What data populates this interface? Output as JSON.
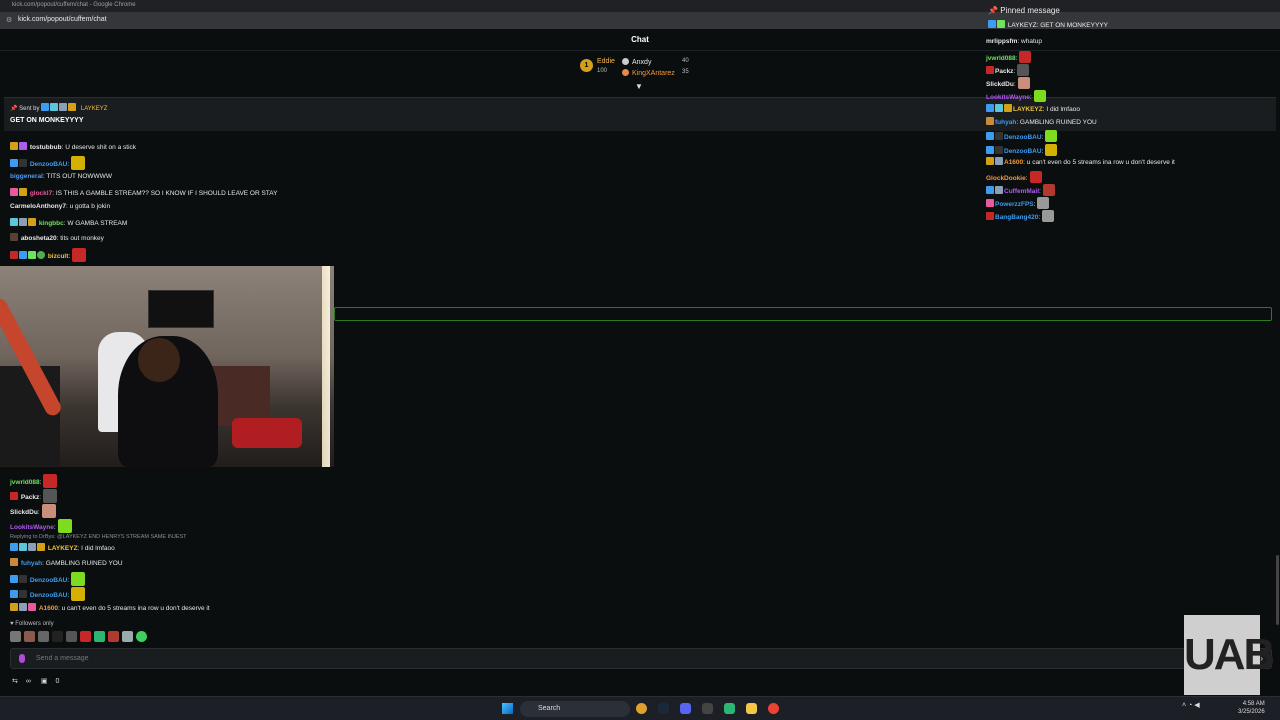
{
  "browser": {
    "window_title": "kick.com/popout/cuffem/chat - Google Chrome",
    "url": "kick.com/popout/cuffem/chat"
  },
  "chat": {
    "title": "Chat",
    "leaderboard": {
      "top": {
        "rank": "1",
        "name": "Eddie",
        "count": "100"
      },
      "rows": [
        {
          "name": "Anxdy",
          "count": "40",
          "color": "#e8e8e8"
        },
        {
          "name": "KingXAntarez",
          "count": "35",
          "color": "#f39a3a"
        }
      ]
    },
    "pinned": {
      "sent_by_label": "Sent by",
      "sender": "LAYKEYZ",
      "message": "GET ON MONKEYYYY"
    },
    "messages_top": [
      {
        "user": "tostubbub",
        "color": "#e8e8e8",
        "text": ": U deserve shit on a stick"
      },
      {
        "user": "DenzooBAU",
        "color": "#3d9cf0",
        "text": ":"
      },
      {
        "user": "biggeneral",
        "color": "#4f9cf4",
        "text": ": TITS OUT NOWWWW"
      },
      {
        "user": "glockl7",
        "color": "#e85a9b",
        "text": ": IS THIS A GAMBLE STREAM?? SO I KNOW IF I SHOULD LEAVE OR STAY"
      },
      {
        "user": "CarmeloAnthony7",
        "color": "#e8e8e8",
        "text": ": u gotta b jokin"
      },
      {
        "user": "kingbbc",
        "color": "#6fe35a",
        "text": ": W GAMBA STREAM"
      },
      {
        "user": "abosheta20",
        "color": "#e8e8e8",
        "text": ": tits out monkey"
      },
      {
        "user": "bizcult",
        "color": "#f0c23b",
        "text": ":"
      }
    ],
    "messages_bottom": [
      {
        "user": "jvwrld088",
        "color": "#6fe35a",
        "text": ":"
      },
      {
        "user": "Packz",
        "color": "#e8e8e8",
        "text": ":"
      },
      {
        "user": "SlickdDu",
        "color": "#e8e8e8",
        "text": ":"
      },
      {
        "user": "LookitsWayne",
        "color": "#b05bf0",
        "text": ":"
      },
      {
        "user": "LAYKEYZ",
        "color": "#f0c23b",
        "text": ": I did lmfaoo"
      },
      {
        "user": "fuhyah",
        "color": "#3d9cf0",
        "text": ": GAMBLING RUINED YOU"
      },
      {
        "user": "DenzooBAU",
        "color": "#3d9cf0",
        "text": ":"
      },
      {
        "user": "DenzooBAU",
        "color": "#3d9cf0",
        "text": ":"
      },
      {
        "user": "A1600",
        "color": "#f39a3a",
        "text": ": u can't even do 5 streams ina row u don't deserve it"
      }
    ],
    "reply_note": "Replying to DrBys: @LAYKEYZ END HENRYS STREAM SAME INJEST",
    "followers_only": "Followers only",
    "input_placeholder": "Send a message",
    "bottom_stats": {
      "a": "∞",
      "b": "0"
    }
  },
  "overlay": {
    "pinned_title": "Pinned message",
    "pinned_line": "LAYKEYZ: GET ON MONKEYYYY",
    "messages": [
      {
        "user": "mrlippsfm",
        "color": "#e8e8e8",
        "text": ": whatup"
      },
      {
        "user": "jvwrld088",
        "color": "#6fe35a",
        "text": ":"
      },
      {
        "user": "Packz",
        "color": "#e8e8e8",
        "text": ":"
      },
      {
        "user": "SlickdDu",
        "color": "#e8e8e8",
        "text": ":"
      },
      {
        "user": "LookitsWayne",
        "color": "#b05bf0",
        "text": ":"
      },
      {
        "user": "LAYKEYZ",
        "color": "#f0c23b",
        "text": ": I did lmfaoo"
      },
      {
        "user": "fuhyah",
        "color": "#3d9cf0",
        "text": ": GAMBLING RUINED YOU"
      },
      {
        "user": "DenzooBAU",
        "color": "#3d9cf0",
        "text": ":"
      },
      {
        "user": "DenzooBAU",
        "color": "#3d9cf0",
        "text": ":"
      },
      {
        "user": "A1600",
        "color": "#f39a3a",
        "text": ": u can't even do 5 streams ina row u don't deserve it"
      },
      {
        "user": "GlockDookie",
        "color": "#f39a3a",
        "text": ":"
      },
      {
        "user": "CuffemMail",
        "color": "#b05bf0",
        "text": ":"
      },
      {
        "user": "PowerzzFPS",
        "color": "#3d9cf0",
        "text": ":"
      },
      {
        "user": "BangBang420",
        "color": "#3d9cf0",
        "text": ":"
      }
    ]
  },
  "webcam_logo": "UAB",
  "taskbar": {
    "search_label": "Search",
    "time": "4:58 AM",
    "date": "3/25/2026"
  }
}
